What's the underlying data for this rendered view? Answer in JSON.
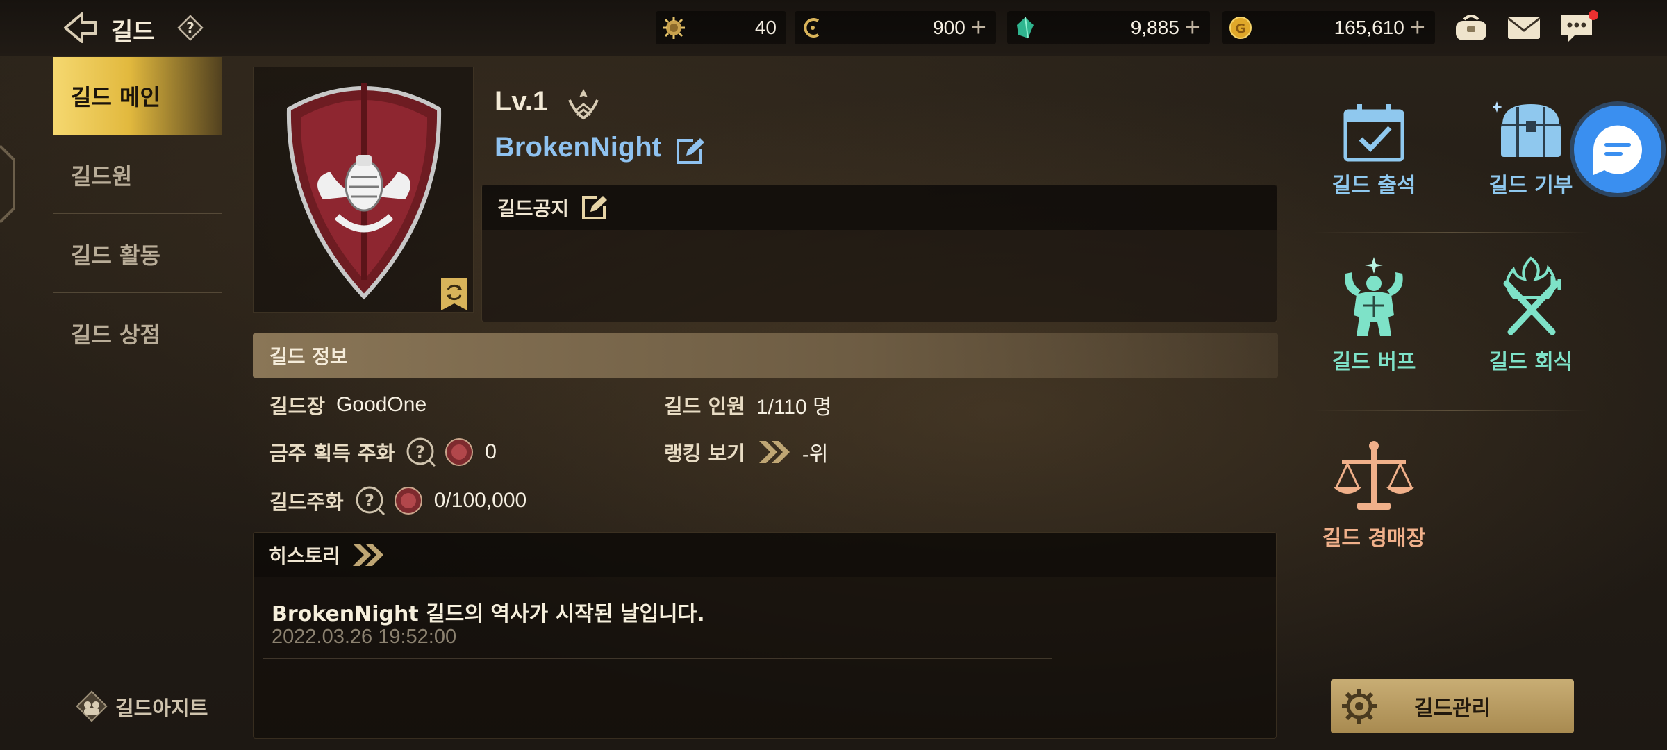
{
  "header": {
    "title": "길드",
    "currencies": [
      {
        "name": "stamina",
        "value": "40",
        "has_plus": false
      },
      {
        "name": "crystal-c",
        "value": "900",
        "has_plus": true
      },
      {
        "name": "gem",
        "value": "9,885",
        "has_plus": true
      },
      {
        "name": "gold",
        "value": "165,610",
        "has_plus": true
      }
    ],
    "has_chat_notification": true
  },
  "sidebar": {
    "items": [
      {
        "label": "길드 메인",
        "active": true
      },
      {
        "label": "길드원",
        "active": false
      },
      {
        "label": "길드 활동",
        "active": false
      },
      {
        "label": "길드 상점",
        "active": false
      }
    ],
    "hideout_label": "길드아지트"
  },
  "guild": {
    "level": "Lv.1",
    "name": "BrokenNight",
    "notice_label": "길드공지",
    "notice_text": ""
  },
  "info": {
    "header": "길드 정보",
    "leader_label": "길드장",
    "leader_value": "GoodOne",
    "members_label": "길드 인원",
    "members_value": "1/110 명",
    "weekly_coin_label": "금주 획득 주화",
    "weekly_coin_value": "0",
    "ranking_label": "랭킹 보기",
    "ranking_value": "-위",
    "guild_coin_label": "길드주화",
    "guild_coin_value": "0/100,000"
  },
  "history": {
    "label": "히스토리",
    "entries": [
      {
        "text": "BrokenNight 길드의 역사가 시작된 날입니다.",
        "date": "2022.03.26 19:52:00"
      }
    ]
  },
  "menu": {
    "attendance": "길드 출석",
    "donation": "길드 기부",
    "buff": "길드 버프",
    "feast": "길드 회식",
    "auction": "길드 경매장",
    "manage": "길드관리"
  },
  "colors": {
    "accent_gold": "#e2b93e",
    "name_blue": "#8fc2f0",
    "menu_blue": "#8fc8ee",
    "menu_green": "#7ee2c8",
    "menu_orange": "#f0b08a"
  }
}
